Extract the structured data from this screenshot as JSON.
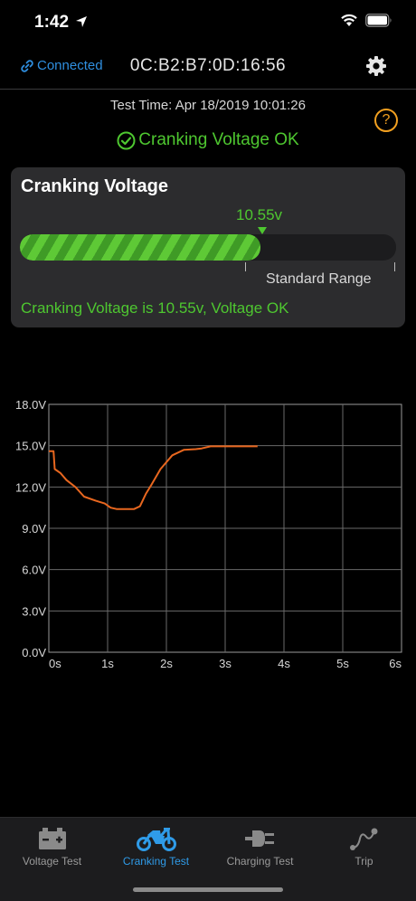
{
  "status_bar": {
    "time": "1:42"
  },
  "header": {
    "connection_label": "Connected",
    "device_mac": "0C:B2:B7:0D:16:56"
  },
  "test_time": "Test Time:  Apr 18/2019 10:01:26",
  "status_message": "Cranking Voltage OK",
  "card": {
    "title": "Cranking Voltage",
    "value_label": "10.55v",
    "fill_fraction": 0.64,
    "range_label": "Standard Range",
    "message": "Cranking Voltage is 10.55v, Voltage OK"
  },
  "colors": {
    "accent_blue": "#2f9be8",
    "ok_green": "#4ec730",
    "warning_orange": "#f2a020",
    "line_orange": "#e8671f"
  },
  "chart_data": {
    "type": "line",
    "title": "",
    "xlabel": "",
    "ylabel": "",
    "xlim": [
      0,
      6
    ],
    "ylim": [
      0,
      18
    ],
    "x_ticks": [
      "0s",
      "1s",
      "2s",
      "3s",
      "4s",
      "5s",
      "6s"
    ],
    "y_ticks": [
      "0.0V",
      "3.0V",
      "6.0V",
      "9.0V",
      "12.0V",
      "15.0V",
      "18.0V"
    ],
    "grid": true,
    "series": [
      {
        "color": "#e8671f",
        "x": [
          0,
          0.08,
          0.1,
          0.2,
          0.3,
          0.45,
          0.6,
          0.8,
          0.95,
          1.05,
          1.15,
          1.3,
          1.45,
          1.55,
          1.65,
          1.75,
          1.9,
          2.1,
          2.3,
          2.5,
          2.6,
          2.75,
          3.0,
          3.3,
          3.55
        ],
        "y": [
          14.6,
          14.6,
          13.3,
          13.0,
          12.5,
          12.0,
          11.3,
          11.0,
          10.8,
          10.5,
          10.4,
          10.4,
          10.4,
          10.6,
          11.5,
          12.2,
          13.3,
          14.3,
          14.7,
          14.75,
          14.8,
          14.95,
          14.95,
          14.95,
          14.95
        ]
      }
    ]
  },
  "tabs": [
    {
      "label": "Voltage Test",
      "icon": "battery-icon",
      "active": false
    },
    {
      "label": "Cranking Test",
      "icon": "motorcycle-icon",
      "active": true
    },
    {
      "label": "Charging Test",
      "icon": "plug-icon",
      "active": false
    },
    {
      "label": "Trip",
      "icon": "route-icon",
      "active": false
    }
  ]
}
